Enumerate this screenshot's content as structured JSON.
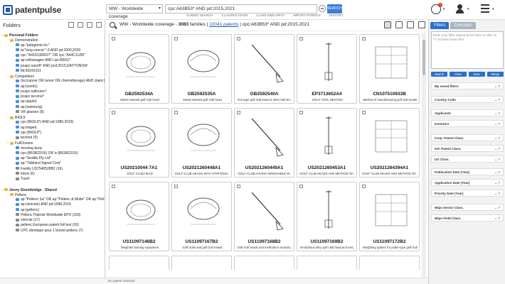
{
  "header": {
    "logo": "patentpulse",
    "coverage": "WW - Worldwide coverage",
    "query": "cpc:A63B53* AND pd:2015,2021",
    "search_label": "SEARCH",
    "links": [
      "GUIDED SEARCH",
      "CLASSIFICATION",
      "CLAIM SIMILARITY",
      "IMPORT PATENTS",
      "HISTORY"
    ],
    "notification_count": "1"
  },
  "left": {
    "title": "Folders",
    "tree": [
      {
        "label": "Personal Folders",
        "type": "root"
      },
      {
        "label": "Demonstration",
        "type": "folder"
      },
      {
        "label": "ap:\"patagonia Inc\"",
        "type": "search"
      },
      {
        "label": "ta:\"lung cancer\"~3 AND pd:2000,2020",
        "type": "search"
      },
      {
        "label": "cpc:\"A41D19/0027\" OR cpc:\"A44C11/00\"",
        "type": "search"
      },
      {
        "label": "ap:volkswagen AND cpc:B60G*",
        "type": "search"
      },
      {
        "label": "pcapc:sanofi* AND pcd:2015,DAYTONOW",
        "type": "search"
      },
      {
        "label": "fid:56243151",
        "type": "search"
      },
      {
        "label": "Competitors",
        "type": "folder"
      },
      {
        "label": "(ta:(cancer OR tumor OR chemotherapy) AND claim:)",
        "type": "search"
      },
      {
        "label": "ap:(somfy)",
        "type": "search"
      },
      {
        "label": "pcapc:vallourec*",
        "type": "search"
      },
      {
        "label": "pcapc:accona*",
        "type": "search"
      },
      {
        "label": "ap:(apple)",
        "type": "search"
      },
      {
        "label": "ap:(samsung)",
        "type": "search"
      },
      {
        "label": "VR glasses (8)",
        "type": "doc"
      },
      {
        "label": "B43L9",
        "type": "folder"
      },
      {
        "label": "cpc:(B43L9*) AND pd:1980,2019)",
        "type": "search"
      },
      {
        "label": "ap:maped",
        "type": "search"
      },
      {
        "label": "cpc:(B43L9*)",
        "type": "search"
      },
      {
        "label": "technot (5)",
        "type": "doc"
      },
      {
        "label": "FullOceans",
        "type": "folder"
      },
      {
        "label": "mooring buoy",
        "type": "search"
      },
      {
        "label": "cpc:(B63B22/16) OR ic:(B63B22/16)",
        "type": "search"
      },
      {
        "label": "ap:\"Seattle Pty Ltd\"",
        "type": "search"
      },
      {
        "label": "ap:\"Tideland Signal Corp\"",
        "type": "search"
      },
      {
        "label": "Family US7540528B2 (16)",
        "type": "doc"
      },
      {
        "label": "Inbox (6)",
        "type": "doc"
      },
      {
        "label": "Trash",
        "type": "doc"
      },
      {
        "label": "",
        "type": "blank"
      },
      {
        "label": "Jenny Stormbridge - Shared",
        "type": "root"
      },
      {
        "label": "Pellenc",
        "type": "folder"
      },
      {
        "label": "ap:\"Pellenc Sa\" OR ap:\"Pellenc & Motte\" OR ap:\"Pell",
        "type": "search"
      },
      {
        "label": "ap:(vinicole) AND pd:1998,2018",
        "type": "search"
      },
      {
        "label": "ap:(pellenc)",
        "type": "search"
      },
      {
        "label": "Pellenc Patents Worldwide EPO (183)",
        "type": "doc"
      },
      {
        "label": "vinicole (17)",
        "type": "doc"
      },
      {
        "label": "pellenc European patent full text (10)",
        "type": "doc"
      },
      {
        "label": "CPC identique pour 1 brevet pellenc (7)",
        "type": "doc"
      }
    ]
  },
  "results": {
    "coverage": "WW - Worldwide coverage - ",
    "families": "3083",
    "families_label": " families | ",
    "patents_link": "10041 patents",
    "query_suffix": " | cpc:A63B53* AND pd:2015,2021",
    "cards": [
      {
        "number": "GB2592534A",
        "title": "Mixed material golf club head"
      },
      {
        "number": "GB2592535A",
        "title": "Mixed material golf club head"
      },
      {
        "number": "GB2592540A",
        "title": "Iron-type golf club head or other ball stri..."
      },
      {
        "number": "EP3713652A4",
        "title": "GOLF TOOL DEVICES"
      },
      {
        "number": "CN107510933B",
        "title": "Method of manufacturing golf club heads"
      },
      {
        "number": "US20210044 7A1",
        "title": "GOLF CLUB HEAD"
      },
      {
        "number": "US2021260448A1",
        "title": "GOLF CLUB HEADS WITH STIFFENIN..."
      },
      {
        "number": "US2021260449A1",
        "title": "GOLF CLUB HAVING REMOVABLE W..."
      },
      {
        "number": "US2021260453A1",
        "title": "GOLF CLUB HEADS AND METHOD OF..."
      },
      {
        "number": "US2021264394A1",
        "title": "GOLF CLUB HEADS AND METHOD OF..."
      },
      {
        "number": "US11097146B2",
        "title": "Weighted training equipment"
      },
      {
        "number": "US11097167B2",
        "title": "Golf clubs and golf club heads"
      },
      {
        "number": "US11097168B2",
        "title": "Golf club heads and methods to manufa..."
      },
      {
        "number": "US11097169B2",
        "title": "Amorphous alloy golf club head and met..."
      },
      {
        "number": "US11097172B2",
        "title": "Weighting system for putter-type golf club"
      }
    ],
    "status": "No patent selected"
  },
  "filters": {
    "tab_filters": "Filters",
    "tab_concepts": "Concepts",
    "placeholder": "Enter your filter search terms here or click on \"?\" to have more info!",
    "buttons": [
      "Search",
      "Clear",
      "Save",
      "Merge"
    ],
    "facets": [
      "My saved filters",
      "Country Code",
      "Applicants",
      "Inventors",
      "Corp. Patent Class.",
      "Intl. Patent Class.",
      "US Class.",
      "Publication Date (Year)",
      "Application Date (Year)",
      "Priority Date (Year)",
      "Wipo Sector Class.",
      "Wipo Field Class."
    ]
  }
}
